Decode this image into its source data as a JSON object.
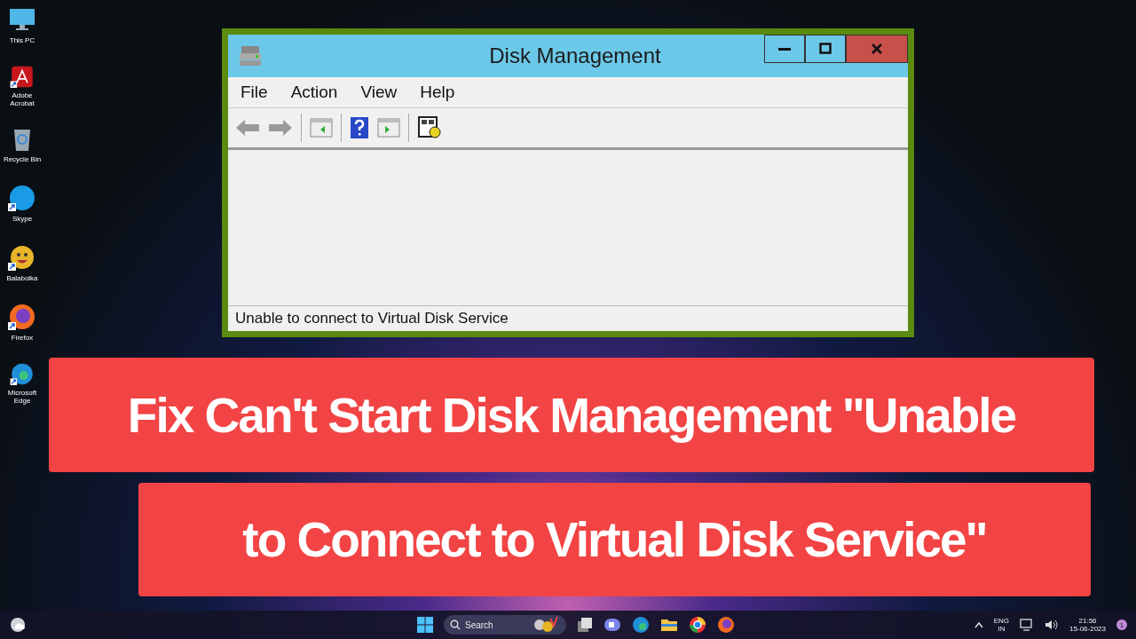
{
  "desktop_icons": [
    {
      "kind": "pc",
      "label": "This PC",
      "shortcut": false
    },
    {
      "kind": "acrobat",
      "label": "Adobe Acrobat",
      "shortcut": true
    },
    {
      "kind": "bin",
      "label": "Recycle Bin",
      "shortcut": false
    },
    {
      "kind": "skype",
      "label": "Skype",
      "shortcut": true
    },
    {
      "kind": "balabolka",
      "label": "Balabolka",
      "shortcut": true
    },
    {
      "kind": "firefox",
      "label": "Firefox",
      "shortcut": true
    },
    {
      "kind": "edge",
      "label": "Microsoft Edge",
      "shortcut": true
    }
  ],
  "window": {
    "title": "Disk Management",
    "menu": [
      "File",
      "Action",
      "View",
      "Help"
    ],
    "status_bar": "Unable to connect to Virtual Disk Service"
  },
  "caption": {
    "lines": [
      "Fix Can't Start Disk Management \"Unable",
      "to Connect to Virtual Disk Service\""
    ]
  },
  "taskbar": {
    "search": {
      "placeholder": "Search"
    },
    "language": [
      "ENG",
      "IN"
    ],
    "time": "21:56",
    "date": "15-06-2023",
    "notification_count": "1"
  }
}
